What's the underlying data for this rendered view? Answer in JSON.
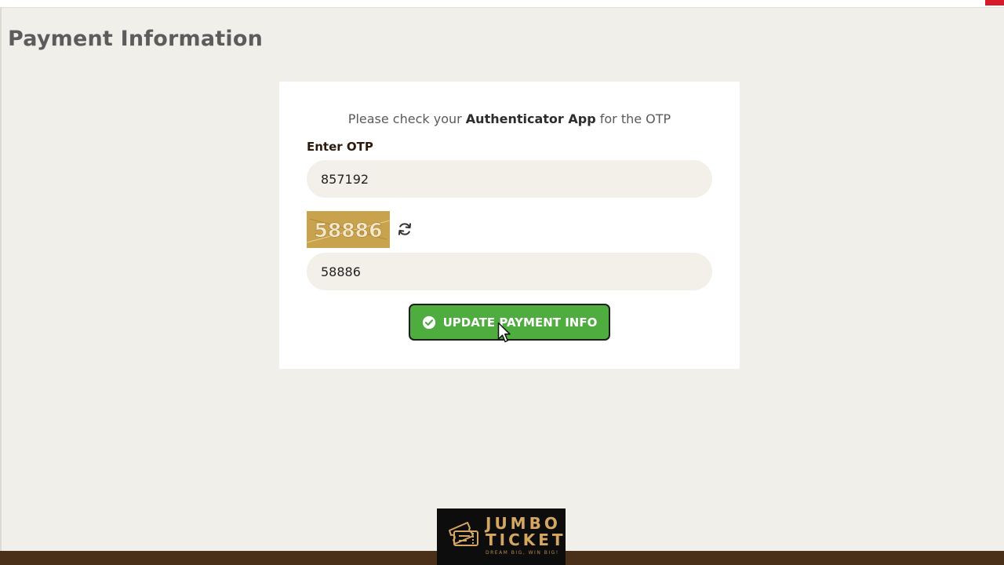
{
  "page": {
    "title": "Payment Information"
  },
  "form": {
    "notice_prefix": "Please check your ",
    "notice_app": "Authenticator App",
    "notice_suffix": " for the OTP",
    "otp_label": "Enter OTP",
    "otp_value": "857192",
    "captcha_text": "58886",
    "captcha_value": "58886",
    "submit_label": "UPDATE PAYMENT INFO"
  },
  "logo": {
    "line1": "JUMBO",
    "line2": "TICKET",
    "tagline": "DREAM BIG, WIN BIG!"
  },
  "colors": {
    "background": "#f1efea",
    "card": "#ffffff",
    "button": "#4fac3f",
    "captcha_bg": "#c9a24e",
    "footer": "#4a2f19",
    "logo_gold": "#d5a661"
  },
  "icons": {
    "refresh": "refresh-icon",
    "check": "check-circle-icon",
    "cursor": "mouse-pointer-icon"
  }
}
